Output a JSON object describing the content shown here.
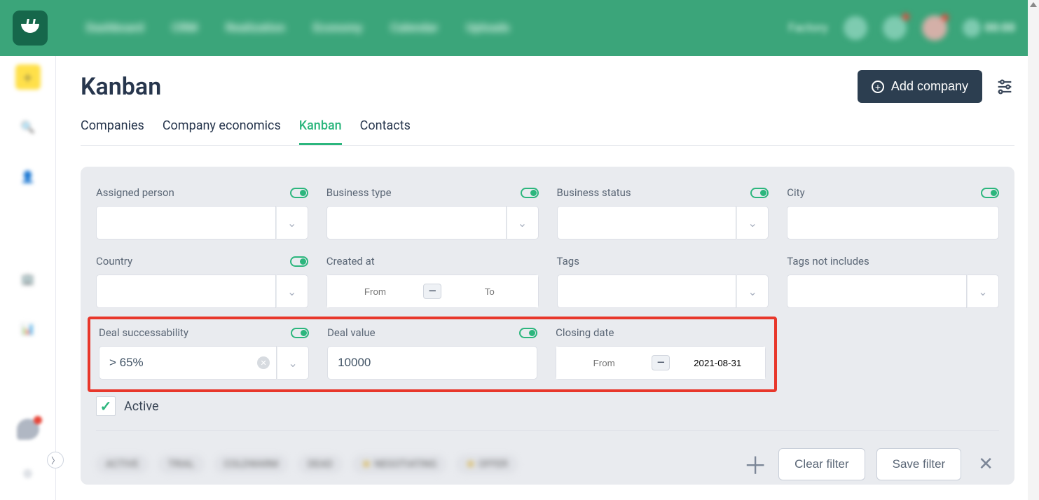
{
  "brand": {
    "color": "#3ba57a"
  },
  "topnav": [
    "Dashboard",
    "CRM",
    "Realization",
    "Economy",
    "Calendar",
    "Uploads"
  ],
  "topright": {
    "org": "Factory",
    "timer": "00:00"
  },
  "page_title": "Kanban",
  "add_button_label": "Add company",
  "tabs": [
    {
      "id": "companies",
      "label": "Companies",
      "active": false
    },
    {
      "id": "economics",
      "label": "Company economics",
      "active": false
    },
    {
      "id": "kanban",
      "label": "Kanban",
      "active": true
    },
    {
      "id": "contacts",
      "label": "Contacts",
      "active": false
    }
  ],
  "filters": {
    "assigned_person": {
      "label": "Assigned person",
      "value": ""
    },
    "business_type": {
      "label": "Business type",
      "value": ""
    },
    "business_status": {
      "label": "Business status",
      "value": ""
    },
    "city": {
      "label": "City",
      "value": ""
    },
    "country": {
      "label": "Country",
      "value": ""
    },
    "created_at": {
      "label": "Created at",
      "from": "",
      "to": "",
      "from_ph": "From",
      "to_ph": "To",
      "sep": "—"
    },
    "tags": {
      "label": "Tags",
      "value": ""
    },
    "tags_not": {
      "label": "Tags not includes",
      "value": ""
    },
    "deal_success": {
      "label": "Deal successability",
      "value": "> 65%"
    },
    "deal_value": {
      "label": "Deal value",
      "value": "10000"
    },
    "closing_date": {
      "label": "Closing date",
      "from": "",
      "to": "2021-08-31",
      "from_ph": "From",
      "to_ph": "",
      "sep": "—"
    }
  },
  "active_checkbox": {
    "label": "Active",
    "checked": true
  },
  "status_tags": [
    "ACTIVE",
    "TRIAL",
    "COLDWARM",
    "DEAD",
    "NEGOTIATING",
    "OFFER"
  ],
  "footer": {
    "clear": "Clear filter",
    "save": "Save filter"
  }
}
